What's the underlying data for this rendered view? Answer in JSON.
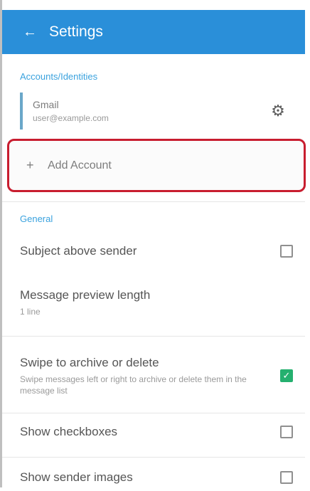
{
  "app": {
    "title": "Settings"
  },
  "sections": {
    "accounts_header": "Accounts/Identities",
    "general_header": "General"
  },
  "account": {
    "name": "Gmail",
    "email": "user@example.com"
  },
  "add_account": {
    "label": "Add Account"
  },
  "settings": {
    "items": [
      {
        "title": "Subject above sender",
        "subtitle": "",
        "checked": false
      },
      {
        "title": "Message preview length",
        "subtitle": "1 line",
        "checked": null
      },
      {
        "title": "Swipe to archive or delete",
        "subtitle": "Swipe messages left or right to archive or delete them in the message list",
        "checked": true
      },
      {
        "title": "Show checkboxes",
        "subtitle": "",
        "checked": false
      },
      {
        "title": "Show sender images",
        "subtitle": "",
        "checked": false
      }
    ]
  },
  "colors": {
    "appbar": "#2a8fd9",
    "accent": "#3aa2de",
    "highlight": "#c81d2f",
    "check_on": "#25b06f"
  }
}
